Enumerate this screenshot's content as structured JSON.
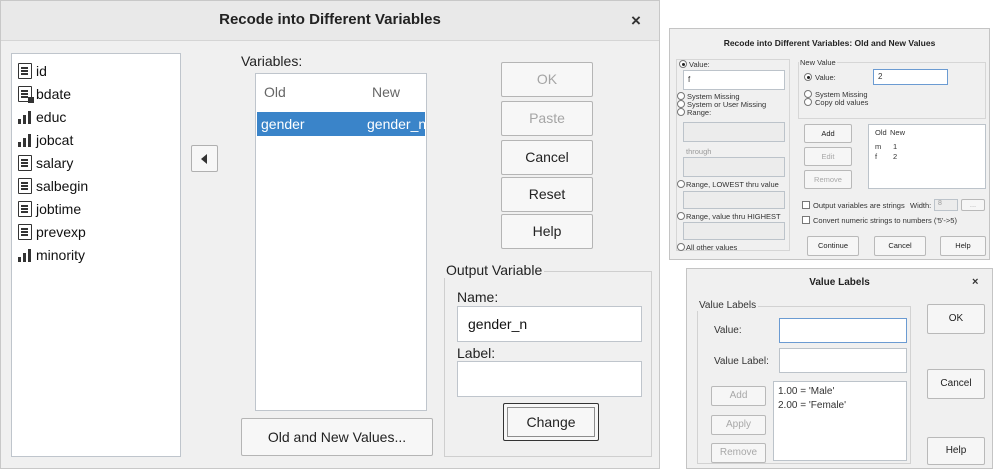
{
  "recode_dialog": {
    "title": "Recode into Different Variables",
    "close_glyph": "×",
    "source_variables": [
      {
        "name": "id",
        "icon": "nominal-icon"
      },
      {
        "name": "bdate",
        "icon": "date-icon"
      },
      {
        "name": "educ",
        "icon": "scale-icon"
      },
      {
        "name": "jobcat",
        "icon": "scale-icon"
      },
      {
        "name": "salary",
        "icon": "nominal-icon"
      },
      {
        "name": "salbegin",
        "icon": "nominal-icon"
      },
      {
        "name": "jobtime",
        "icon": "nominal-icon"
      },
      {
        "name": "prevexp",
        "icon": "nominal-icon"
      },
      {
        "name": "minority",
        "icon": "scale-icon"
      }
    ],
    "variables_label": "Variables:",
    "columns": {
      "old": "Old",
      "new": "New"
    },
    "rows": [
      {
        "old": "gender",
        "new": "gender_n"
      }
    ],
    "buttons": {
      "ok": "OK",
      "paste": "Paste",
      "cancel": "Cancel",
      "reset": "Reset",
      "help": "Help",
      "old_new_values": "Old and New Values...",
      "change": "Change"
    },
    "output_variable": {
      "legend": "Output Variable",
      "name_label": "Name:",
      "name_value": "gender_n",
      "label_label": "Label:",
      "label_value": ""
    }
  },
  "old_new_dialog": {
    "title": "Recode into Different Variables: Old and New Values",
    "old_value": {
      "value_label": "Value:",
      "value": "f",
      "system_missing": "System Missing",
      "system_or_user_missing": "System or User Missing",
      "range": "Range:",
      "through": "through",
      "range_lowest": "Range, LOWEST thru value",
      "range_highest": "Range, value thru HIGHEST",
      "all_other": "All other values"
    },
    "new_value": {
      "legend": "New Value",
      "value_label": "Value:",
      "value": "2",
      "system_missing": "System Missing",
      "copy_old": "Copy old values"
    },
    "mapping": {
      "header_old": "Old",
      "header_new": "New",
      "rows": [
        {
          "old": "m",
          "new": "1"
        },
        {
          "old": "f",
          "new": "2"
        }
      ]
    },
    "buttons": {
      "add": "Add",
      "edit": "Edit",
      "remove": "Remove",
      "continue": "Continue",
      "cancel": "Cancel",
      "help": "Help"
    },
    "output_strings": "Output variables are strings",
    "width_label": "Width:",
    "width_value": "8",
    "width_btn": "...",
    "convert_numeric": "Convert numeric strings to numbers ('5'->5)"
  },
  "value_labels_dialog": {
    "title": "Value Labels",
    "close_glyph": "×",
    "group_label": "Value Labels",
    "value_label": "Value:",
    "value": "",
    "value_label_label": "Value Label:",
    "value_label_value": "",
    "list": [
      "1.00 = 'Male'",
      "2.00 = 'Female'"
    ],
    "buttons": {
      "add": "Add",
      "apply": "Apply",
      "remove": "Remove",
      "ok": "OK",
      "cancel": "Cancel",
      "help": "Help"
    }
  }
}
